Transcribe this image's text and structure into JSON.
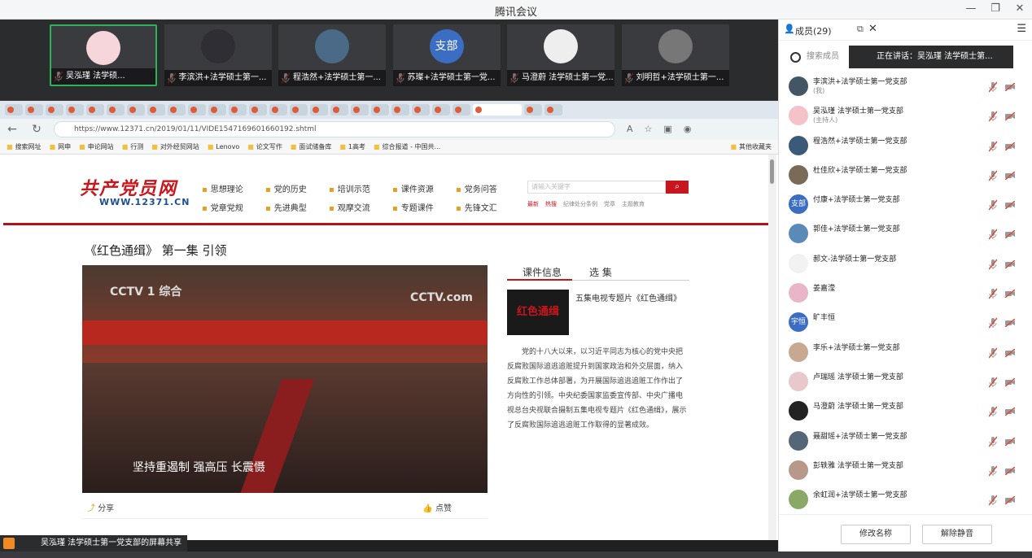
{
  "window": {
    "title": "腾讯会议"
  },
  "videos": [
    {
      "name": "吴泓瑾 法学硕...",
      "avatar": "pink-cartoon",
      "active": true
    },
    {
      "name": "李滨洪+法学硕士第一...",
      "avatar": "man-suit",
      "active": false
    },
    {
      "name": "程浩然+法学硕士第一...",
      "avatar": "landscape",
      "active": false
    },
    {
      "name": "苏璨+法学硕士第一党...",
      "avatar": "支部",
      "active": false
    },
    {
      "name": "马澄蔚 法学硕士第一党...",
      "avatar": "woman",
      "active": false
    },
    {
      "name": "刘明哲+法学硕士第一...",
      "avatar": "man-bw",
      "active": false
    }
  ],
  "browser": {
    "url": "https://www.12371.cn/2019/01/11/VIDE1547169601660192.shtml",
    "bookmarks": [
      "搜索网址",
      "网申",
      "申论网站",
      "行测",
      "对外经贸网站",
      "Lenovo",
      "论文写作",
      "面试储备库",
      "1高考",
      "综合报道 - 中国共...",
      "其他收藏夹"
    ]
  },
  "site": {
    "logo_cn": "共产党员网",
    "logo_en": "WWW.12371.CN",
    "menu": [
      "思想理论",
      "党的历史",
      "培训示范",
      "课件资源",
      "党务问答",
      "党章党规",
      "先进典型",
      "观摩交流",
      "专题课件",
      "先锋文汇"
    ],
    "search_placeholder": "请输入关键字",
    "hot": [
      "最新",
      "热搜",
      "纪律处分条例",
      "党章",
      "主题教育"
    ]
  },
  "article": {
    "title": "《红色通缉》 第一集 引领",
    "video_logo": "CCTV 1 综合",
    "video_logo2": "CCTV.com",
    "subtitle": "坚持重遏制 强高压 长震慑",
    "tab_info": "课件信息",
    "tab_select": "选 集",
    "thumb_text": "红色通缉",
    "course_title": "五集电视专题片《红色通缉》",
    "description": "党的十八大以来，以习近平同志为核心的党中央把反腐败国际追逃追赃提升到国家政治和外交层面，纳入反腐败工作总体部署，为开展国际追逃追赃工作作出了方向性的引领。中央纪委国家监委宣传部、中央广播电视总台央视联合摄制五集电视专题片《红色通缉》，展示了反腐败国际追逃追赃工作取得的显著成效。",
    "share": "分享",
    "like": "点赞"
  },
  "share_bar": "吴泓瑾 法学硕士第一党支部的屏幕共享",
  "panel": {
    "title": "成员(29)",
    "search_placeholder": "搜索成员",
    "speaking": "正在讲话：吴泓瑾 法学硕士第...",
    "members": [
      {
        "name": "李滨洪+法学硕士第一党支部",
        "tag": "(我)",
        "avatar_color": "#445566"
      },
      {
        "name": "吴泓瑾 法学硕士第一党支部",
        "tag": "(主持人)",
        "avatar_color": "#f4c2c8"
      },
      {
        "name": "程浩然+法学硕士第一党支部",
        "tag": "",
        "avatar_color": "#3a5a78"
      },
      {
        "name": "杜佳欣+法学硕士第一党支部",
        "tag": "",
        "avatar_color": "#7a6a58"
      },
      {
        "name": "付康+法学硕士第一党支部",
        "tag": "",
        "avatar_color": "#3b6ec2",
        "avatar_text": "支部"
      },
      {
        "name": "郭佳+法学硕士第一党支部",
        "tag": "",
        "avatar_color": "#5a8ab8"
      },
      {
        "name": "郝文-法学硕士第一党支部",
        "tag": "",
        "avatar_color": "#f2f2f2"
      },
      {
        "name": "姜嘉滢",
        "tag": "",
        "avatar_color": "#e8b6c8"
      },
      {
        "name": "旷丰恒",
        "tag": "",
        "avatar_color": "#3b6ec2",
        "avatar_text": "宇恒"
      },
      {
        "name": "李乐+法学硕士第一党支部",
        "tag": "",
        "avatar_color": "#c8a890"
      },
      {
        "name": "卢瑞瑶 法学硕士第一党支部",
        "tag": "",
        "avatar_color": "#e8c8c8"
      },
      {
        "name": "马澄蔚 法学硕士第一党支部",
        "tag": "",
        "avatar_color": "#222222"
      },
      {
        "name": "聂甜瑶+法学硕士第一党支部",
        "tag": "",
        "avatar_color": "#556677"
      },
      {
        "name": "彭轶雅 法学硕士第一党支部",
        "tag": "",
        "avatar_color": "#b89888"
      },
      {
        "name": "余虹润+法学硕士第一党支部",
        "tag": "",
        "avatar_color": "#8aa866"
      }
    ],
    "rename_btn": "修改名称",
    "unmute_btn": "解除静音"
  }
}
